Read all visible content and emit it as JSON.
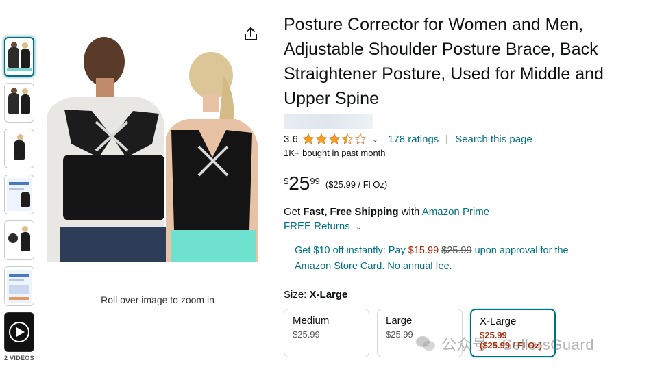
{
  "thumbnails": [
    "thumb-1",
    "thumb-2",
    "thumb-3",
    "thumb-4",
    "thumb-5",
    "thumb-6"
  ],
  "videos_label": "2 VIDEOS",
  "zoom_hint": "Roll over image to zoom in",
  "product": {
    "title": "Posture Corrector for Women and Men, Adjustable Shoulder Posture Brace, Back Straightener Posture, Used for Middle and Upper Spine",
    "rating": "3.6",
    "ratings_count": "178 ratings",
    "search_link": "Search this page",
    "bought": "1K+ bought in past month"
  },
  "price": {
    "currency": "$",
    "whole": "25",
    "fraction": "99",
    "unit_price": "($25.99 / Fl Oz)"
  },
  "shipping": {
    "get": "Get",
    "fast": "Fast, Free Shipping",
    "with": "with",
    "prime": "Amazon Prime",
    "returns": "FREE Returns"
  },
  "card_offer": {
    "p1": "Get $10 off instantly: Pay",
    "new_price": "$15.99",
    "old_price": "$25.99",
    "p2": "upon approval for the Amazon Store Card. No annual fee."
  },
  "size": {
    "label": "Size:",
    "selected": "X-Large",
    "options": [
      {
        "name": "Medium",
        "price": "$25.99"
      },
      {
        "name": "Large",
        "price": "$25.99"
      },
      {
        "name": "X-Large",
        "price": "$25.99",
        "unit": "($25.99 / Fl Oz)"
      }
    ]
  },
  "watermark": "公众号 · SellersGuard",
  "colors": {
    "link": "#007185",
    "price_red": "#b12704",
    "star": "#f79f1a"
  },
  "icons": {
    "share": "share-icon",
    "star": "star-icon",
    "play": "play-icon"
  }
}
